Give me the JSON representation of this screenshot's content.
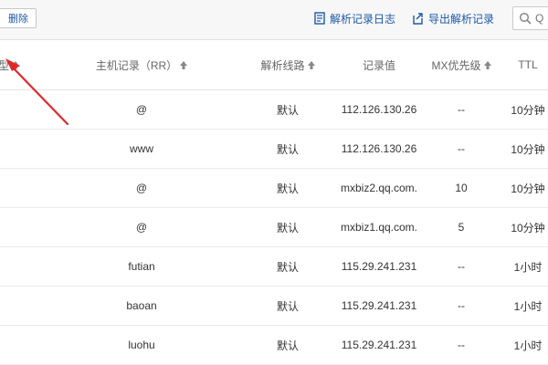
{
  "toolbar": {
    "delete_label": "删除",
    "log_label": "解析记录日志",
    "export_label": "导出解析记录",
    "search_placeholder": "Q",
    "accent": "#1c5aa6"
  },
  "table": {
    "headers": {
      "type": "型",
      "host": "主机记录（RR）",
      "line": "解析线路",
      "value": "记录值",
      "mx": "MX优先级",
      "ttl": "TTL"
    },
    "rows": [
      {
        "type": "",
        "host": "@",
        "line": "默认",
        "value": "112.126.130.26",
        "mx": "--",
        "ttl": "10分钟"
      },
      {
        "type": "",
        "host": "www",
        "line": "默认",
        "value": "112.126.130.26",
        "mx": "--",
        "ttl": "10分钟"
      },
      {
        "type": "(",
        "host": "@",
        "line": "默认",
        "value": "mxbiz2.qq.com.",
        "mx": "10",
        "ttl": "10分钟"
      },
      {
        "type": "(",
        "host": "@",
        "line": "默认",
        "value": "mxbiz1.qq.com.",
        "mx": "5",
        "ttl": "10分钟"
      },
      {
        "type": "",
        "host": "futian",
        "line": "默认",
        "value": "115.29.241.231",
        "mx": "--",
        "ttl": "1小时"
      },
      {
        "type": "",
        "host": "baoan",
        "line": "默认",
        "value": "115.29.241.231",
        "mx": "--",
        "ttl": "1小时"
      },
      {
        "type": "",
        "host": "luohu",
        "line": "默认",
        "value": "115.29.241.231",
        "mx": "--",
        "ttl": "1小时"
      }
    ]
  },
  "annotation": {
    "arrow_color": "#e02a2a"
  }
}
